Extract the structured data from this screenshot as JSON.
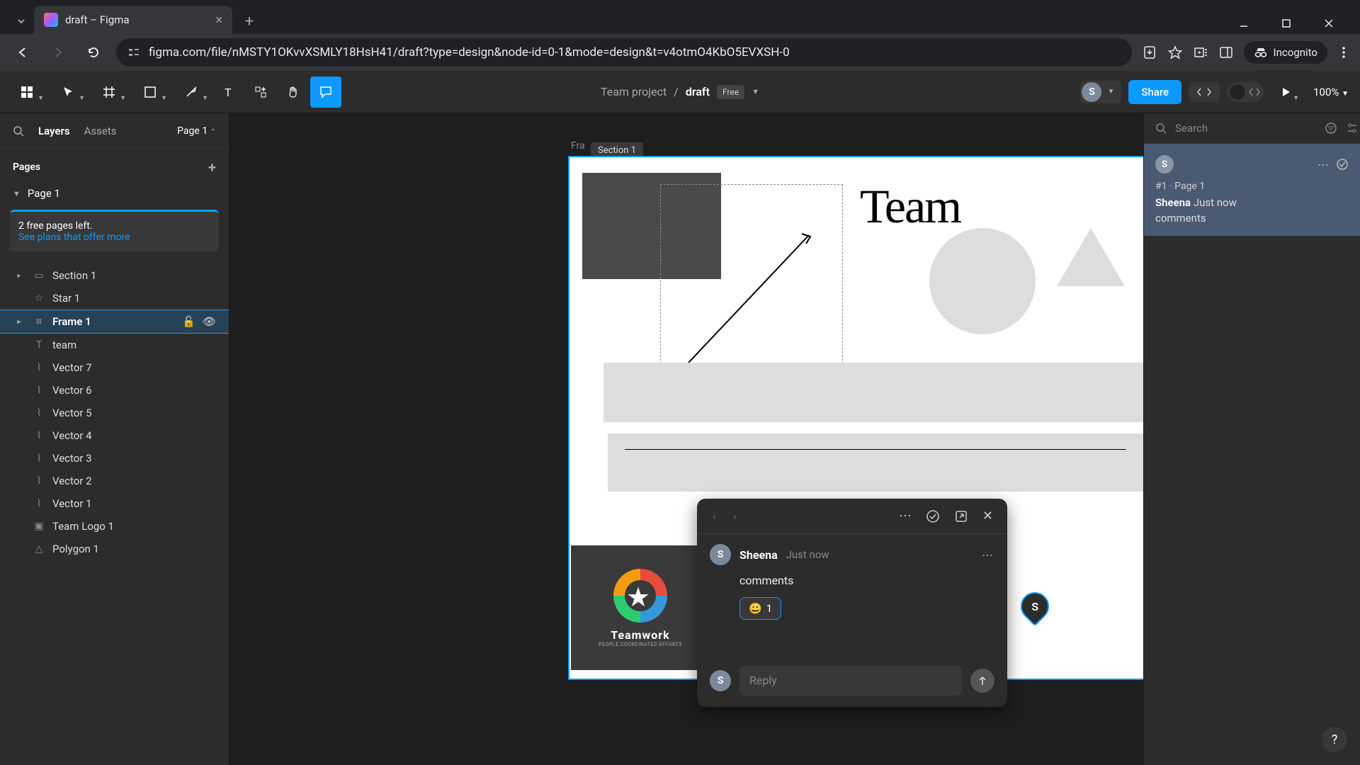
{
  "browser": {
    "tab_title": "draft – Figma",
    "url": "figma.com/file/nMSTY1OKvvXSMLY18HsH41/draft?type=design&node-id=0-1&mode=design&t=v4otmO4KbO5EVXSH-0",
    "incognito_label": "Incognito"
  },
  "toolbar": {
    "team_label": "Team project",
    "file_name": "draft",
    "plan_badge": "Free",
    "share_label": "Share",
    "zoom": "100%",
    "user_initial": "S"
  },
  "left_panel": {
    "tab_layers": "Layers",
    "tab_assets": "Assets",
    "page_selector": "Page 1",
    "pages_header": "Pages",
    "current_page": "Page 1",
    "promo_line1": "2 free pages left.",
    "promo_link": "See plans that offer more",
    "layers": [
      {
        "name": "Section 1",
        "icon": "section",
        "indent": 0
      },
      {
        "name": "Star 1",
        "icon": "star",
        "indent": 1
      },
      {
        "name": "Frame 1",
        "icon": "frame",
        "indent": 0,
        "selected": true
      },
      {
        "name": "team",
        "icon": "text",
        "indent": 1
      },
      {
        "name": "Vector 7",
        "icon": "vector",
        "indent": 1
      },
      {
        "name": "Vector 6",
        "icon": "vector",
        "indent": 1
      },
      {
        "name": "Vector 5",
        "icon": "vector",
        "indent": 1
      },
      {
        "name": "Vector 4",
        "icon": "vector",
        "indent": 1
      },
      {
        "name": "Vector 3",
        "icon": "vector",
        "indent": 1
      },
      {
        "name": "Vector 2",
        "icon": "vector",
        "indent": 1
      },
      {
        "name": "Vector 1",
        "icon": "vector",
        "indent": 1
      },
      {
        "name": "Team Logo 1",
        "icon": "image",
        "indent": 1
      },
      {
        "name": "Polygon 1",
        "icon": "polygon",
        "indent": 1
      }
    ]
  },
  "canvas": {
    "frame_label": "Fra",
    "section_tag": "Section 1",
    "team_text": "Team",
    "logo_text": "Teamwork",
    "logo_sub": "PEOPLE COORDINATED EFFORTS"
  },
  "comment_popup": {
    "author": "Sheena",
    "time": "Just now",
    "text": "comments",
    "reaction_emoji": "😀",
    "reaction_count": "1",
    "reply_placeholder": "Reply",
    "reply_avatar": "S",
    "author_avatar": "S"
  },
  "comment_pin": {
    "initial": "S"
  },
  "right_panel": {
    "search_placeholder": "Search",
    "card": {
      "avatar": "S",
      "ref": "#1 · Page 1",
      "author": "Sheena",
      "time": "Just now",
      "text": "comments"
    }
  },
  "help": "?"
}
